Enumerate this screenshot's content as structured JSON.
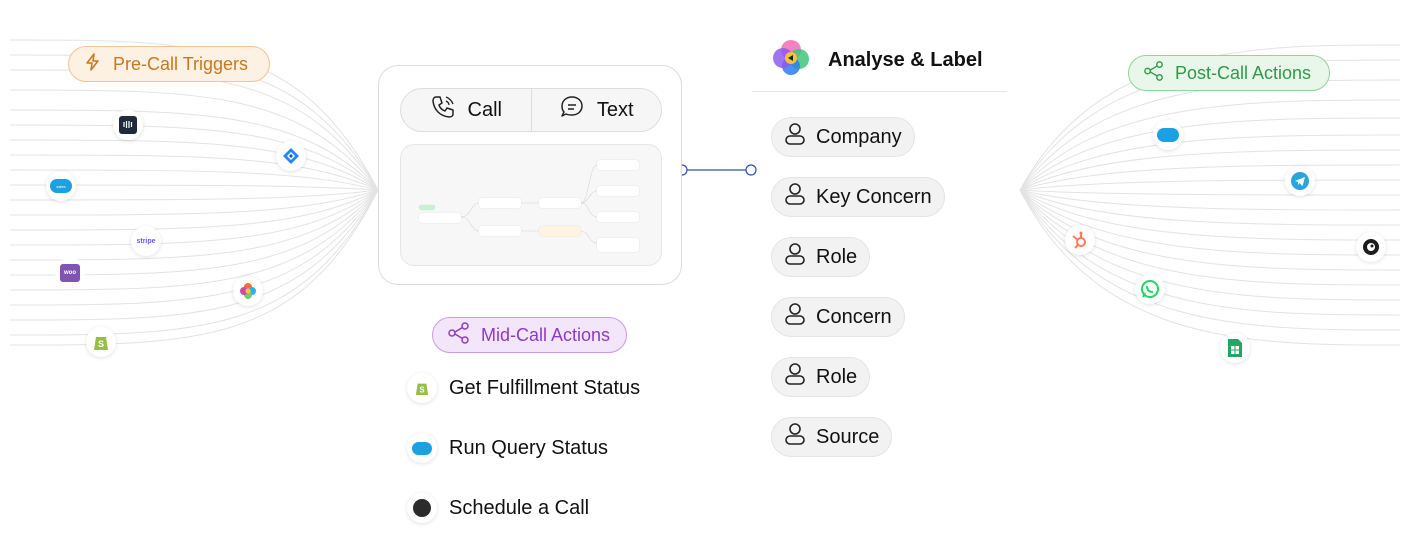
{
  "pre_call": {
    "label": "Pre-Call Triggers"
  },
  "post_call": {
    "label": "Post-Call Actions"
  },
  "mid_call": {
    "label": "Mid-Call Actions"
  },
  "channels": {
    "call": "Call",
    "text": "Text"
  },
  "analyse": {
    "title": "Analyse & Label"
  },
  "labels": [
    "Company",
    "Key Concern",
    "Role",
    "Concern",
    "Role",
    "Source"
  ],
  "mid_actions": [
    "Get Fulfillment Status",
    "Run Query Status",
    "Schedule a Call"
  ],
  "integrations_left": [
    "intercom-icon",
    "jira-icon",
    "salesforce-icon",
    "stripe-icon",
    "woocommerce-icon",
    "pipedrive-icon",
    "shopify-icon"
  ],
  "integrations_right": [
    "salesforce-icon",
    "telegram-icon",
    "mailchimp-icon",
    "hubspot-icon",
    "whatsapp-icon",
    "google-sheets-icon"
  ],
  "colors": {
    "pre": "#c8781e",
    "post": "#2e9a4a",
    "mid": "#8d3bc2",
    "connector": "#2a4fb0"
  }
}
